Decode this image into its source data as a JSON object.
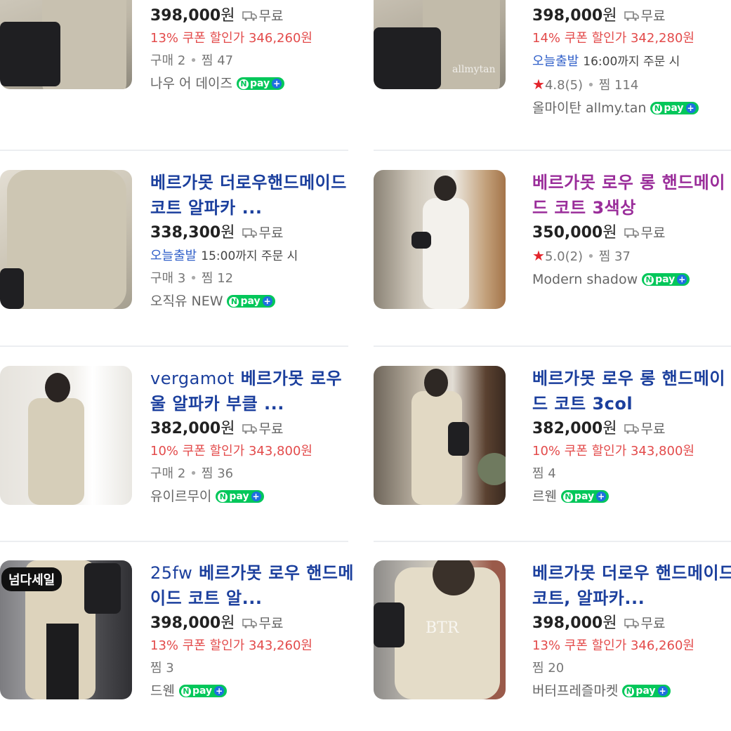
{
  "npay_label": "pay",
  "npay_n": "N",
  "npay_plus": "+",
  "shipping_icon": "truck-icon",
  "accent_colors": {
    "title": "#1b3f9d",
    "visited_title": "#9a2d9a",
    "coupon": "#e34b4b",
    "fast_delivery": "#3160c9",
    "npay": "#03c75a"
  },
  "products": [
    {
      "title_keyword": "",
      "title": "",
      "price": "398,000",
      "won": "원",
      "shipping": "무료",
      "coupon": "13% 쿠폰 할인가 346,260원",
      "stats": "구매 2",
      "likes": "찜 47",
      "store": "나우 어 데이즈"
    },
    {
      "title_keyword": "",
      "title": "",
      "price": "398,000",
      "won": "원",
      "shipping": "무료",
      "coupon": "14% 쿠폰 할인가 342,280원",
      "fast_label": "오늘출발",
      "fast_detail": "16:00까지 주문 시",
      "rating": "4.8(5)",
      "likes": "찜 114",
      "store": "올마이탄 allmy.tan",
      "watermark": "allmytan"
    },
    {
      "title_keyword": "",
      "title": "베르가못 더로우핸드메이드 코트 알파카 ...",
      "price": "338,300",
      "won": "원",
      "shipping": "무료",
      "fast_label": "오늘출발",
      "fast_detail": "15:00까지 주문 시",
      "stats": "구매 3",
      "likes": "찜 12",
      "store": "오직유 NEW"
    },
    {
      "title_keyword": "",
      "title": "베르가못 로우 롱 핸드메이드 코트 3색상",
      "price": "350,000",
      "won": "원",
      "shipping": "무료",
      "rating": "5.0(2)",
      "likes": "찜 37",
      "store": "Modern shadow"
    },
    {
      "title_keyword": "vergamot",
      "title": "베르가못 로우 울 알파카 부클 ...",
      "price": "382,000",
      "won": "원",
      "shipping": "무료",
      "coupon": "10% 쿠폰 할인가 343,800원",
      "stats": "구매 2",
      "likes": "찜 36",
      "store": "유이르무이"
    },
    {
      "title_keyword": "",
      "title": "베르가못 로우 롱 핸드메이드 코트 3col",
      "price": "382,000",
      "won": "원",
      "shipping": "무료",
      "coupon": "10% 쿠폰 할인가 343,800원",
      "likes": "찜 4",
      "store": "르웬"
    },
    {
      "title_keyword": "25fw",
      "title": "베르가못 로우 핸드메이드 코트 알...",
      "price": "398,000",
      "won": "원",
      "shipping": "무료",
      "coupon": "13% 쿠폰 할인가 343,260원",
      "likes": "찜 3",
      "store": "드웬",
      "badge": "넘다세일"
    },
    {
      "title_keyword": "",
      "title": "베르가못 더로우 핸드메이드 코트, 알파카...",
      "price": "398,000",
      "won": "원",
      "shipping": "무료",
      "coupon": "13% 쿠폰 할인가 346,260원",
      "likes": "찜 20",
      "store": "버터프레즐마켓",
      "watermark": "BTR"
    }
  ]
}
